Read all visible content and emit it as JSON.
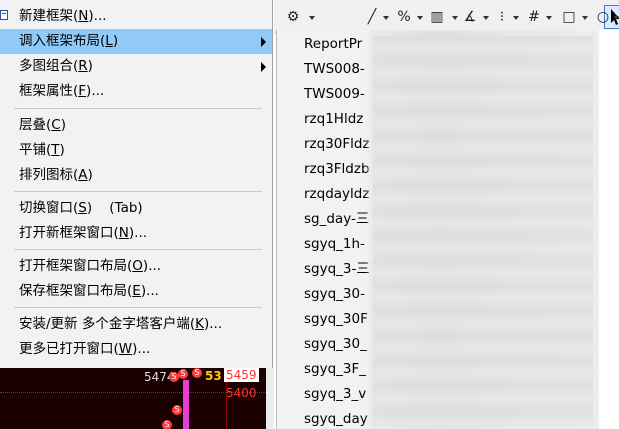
{
  "menu": {
    "items": [
      {
        "pre": "新建框架(",
        "key": "N",
        "post": ")...",
        "highlighted": false,
        "submenu": false
      },
      {
        "pre": "调入框架布局(",
        "key": "L",
        "post": ")",
        "highlighted": true,
        "submenu": true
      },
      {
        "pre": "多图组合(",
        "key": "R",
        "post": ")",
        "highlighted": false,
        "submenu": true
      },
      {
        "pre": "框架属性(",
        "key": "F",
        "post": ")...",
        "highlighted": false,
        "submenu": false
      },
      {
        "pre": "层叠(",
        "key": "C",
        "post": ")",
        "highlighted": false,
        "submenu": false
      },
      {
        "pre": "平铺(",
        "key": "T",
        "post": ")",
        "highlighted": false,
        "submenu": false
      },
      {
        "pre": "排列图标(",
        "key": "A",
        "post": ")",
        "highlighted": false,
        "submenu": false
      },
      {
        "pre": "切换窗口(",
        "key": "S",
        "post": ")    (Tab)",
        "highlighted": false,
        "submenu": false
      },
      {
        "pre": "打开新框架窗口(",
        "key": "N",
        "post": ")...",
        "highlighted": false,
        "submenu": false
      },
      {
        "pre": "打开框架窗口布局(",
        "key": "O",
        "post": ")...",
        "highlighted": false,
        "submenu": false
      },
      {
        "pre": "保存框架窗口布局(",
        "key": "E",
        "post": ")...",
        "highlighted": false,
        "submenu": false
      },
      {
        "pre": "安装/更新 多个金字塔客户端(",
        "key": "K",
        "post": ")...",
        "highlighted": false,
        "submenu": false
      },
      {
        "pre": "更多已打开窗口(",
        "key": "W",
        "post": ")...",
        "highlighted": false,
        "submenu": false
      }
    ]
  },
  "submenu": {
    "items": [
      "ReportPr",
      "TWS008-",
      "TWS009-",
      "rzq1Hldz",
      "rzq30Fldz",
      "rzq3Fldzb",
      "rzqdayldz",
      "sg_day-三",
      "sgyq_1h-",
      "sgyq_3-三",
      "sgyq_30-",
      "sgyq_30F",
      "sgyq_30_",
      "sgyq_3F_",
      "sgyq_3_v",
      "sgyq_day"
    ]
  },
  "chart": {
    "price_a": "5474",
    "price_b": "53",
    "price_c": "5459",
    "price_d": "5400",
    "signal_glyph": "S"
  },
  "toolbar": {
    "gear": "⚙",
    "pencil": "╱",
    "percent": "%",
    "grid": "▥",
    "angle": "∡",
    "fib": "⁝",
    "hash": "#",
    "rect": "□",
    "circle": "○"
  }
}
